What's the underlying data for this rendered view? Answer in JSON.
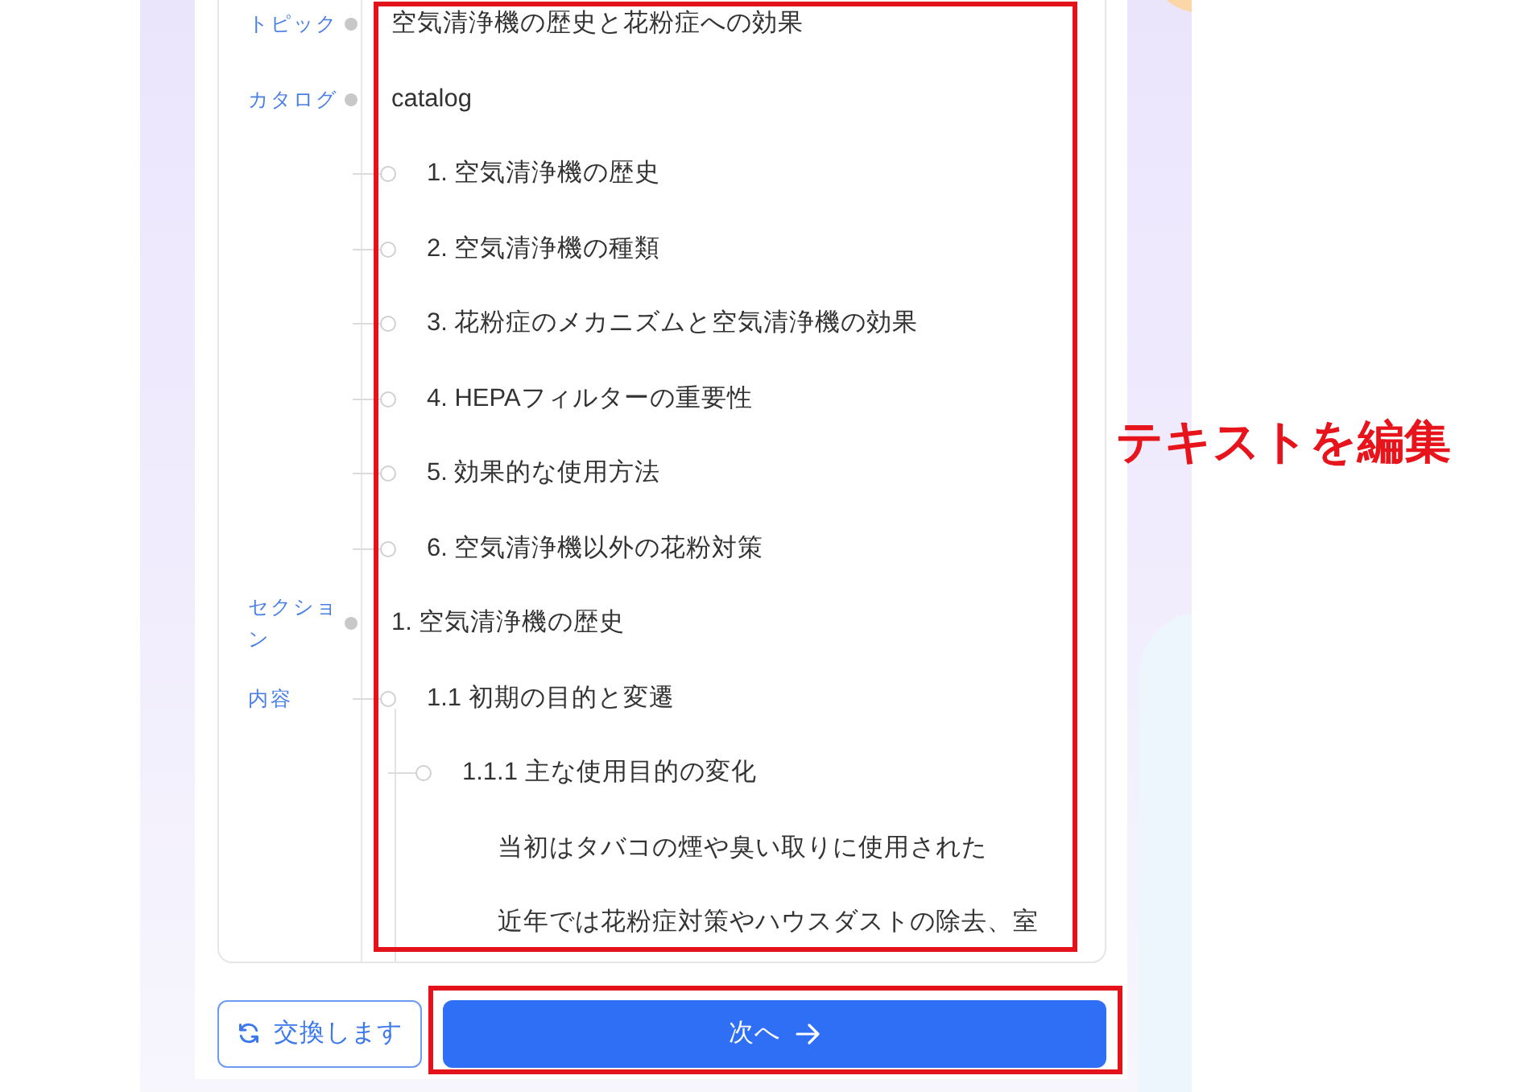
{
  "outline": {
    "framed": true,
    "rows": [
      {
        "label": "トピック",
        "text": "空気清浄機の歴史と花粉症への効果"
      },
      {
        "label": "カタログ",
        "text": "catalog",
        "children": [
          {
            "text": "1. 空気清浄機の歴史"
          },
          {
            "text": "2. 空気清浄機の種類"
          },
          {
            "text": "3. 花粉症のメカニズムと空気清浄機の効果"
          },
          {
            "text": "4. HEPAフィルターの重要性"
          },
          {
            "text": "5. 効果的な使用方法"
          },
          {
            "text": "6. 空気清浄機以外の花粉対策"
          }
        ]
      },
      {
        "label": "セクション",
        "text": "1. 空気清浄機の歴史",
        "children": [
          {
            "label": "内容",
            "text": "1.1 初期の目的と変遷",
            "children": [
              {
                "text": "1.1.1 主な使用目的の変化",
                "children": [
                  {
                    "text": "当初はタバコの煙や臭い取りに使用された"
                  },
                  {
                    "text": "近年では花粉症対策やハウスダストの除去、室"
                  }
                ]
              }
            ]
          }
        ]
      }
    ]
  },
  "actions": [
    {
      "label": "交換します",
      "kind": "secondary"
    },
    {
      "label": "次へ",
      "kind": "primary",
      "framed": true
    }
  ],
  "annotation": {
    "text": "テキストを編集"
  }
}
